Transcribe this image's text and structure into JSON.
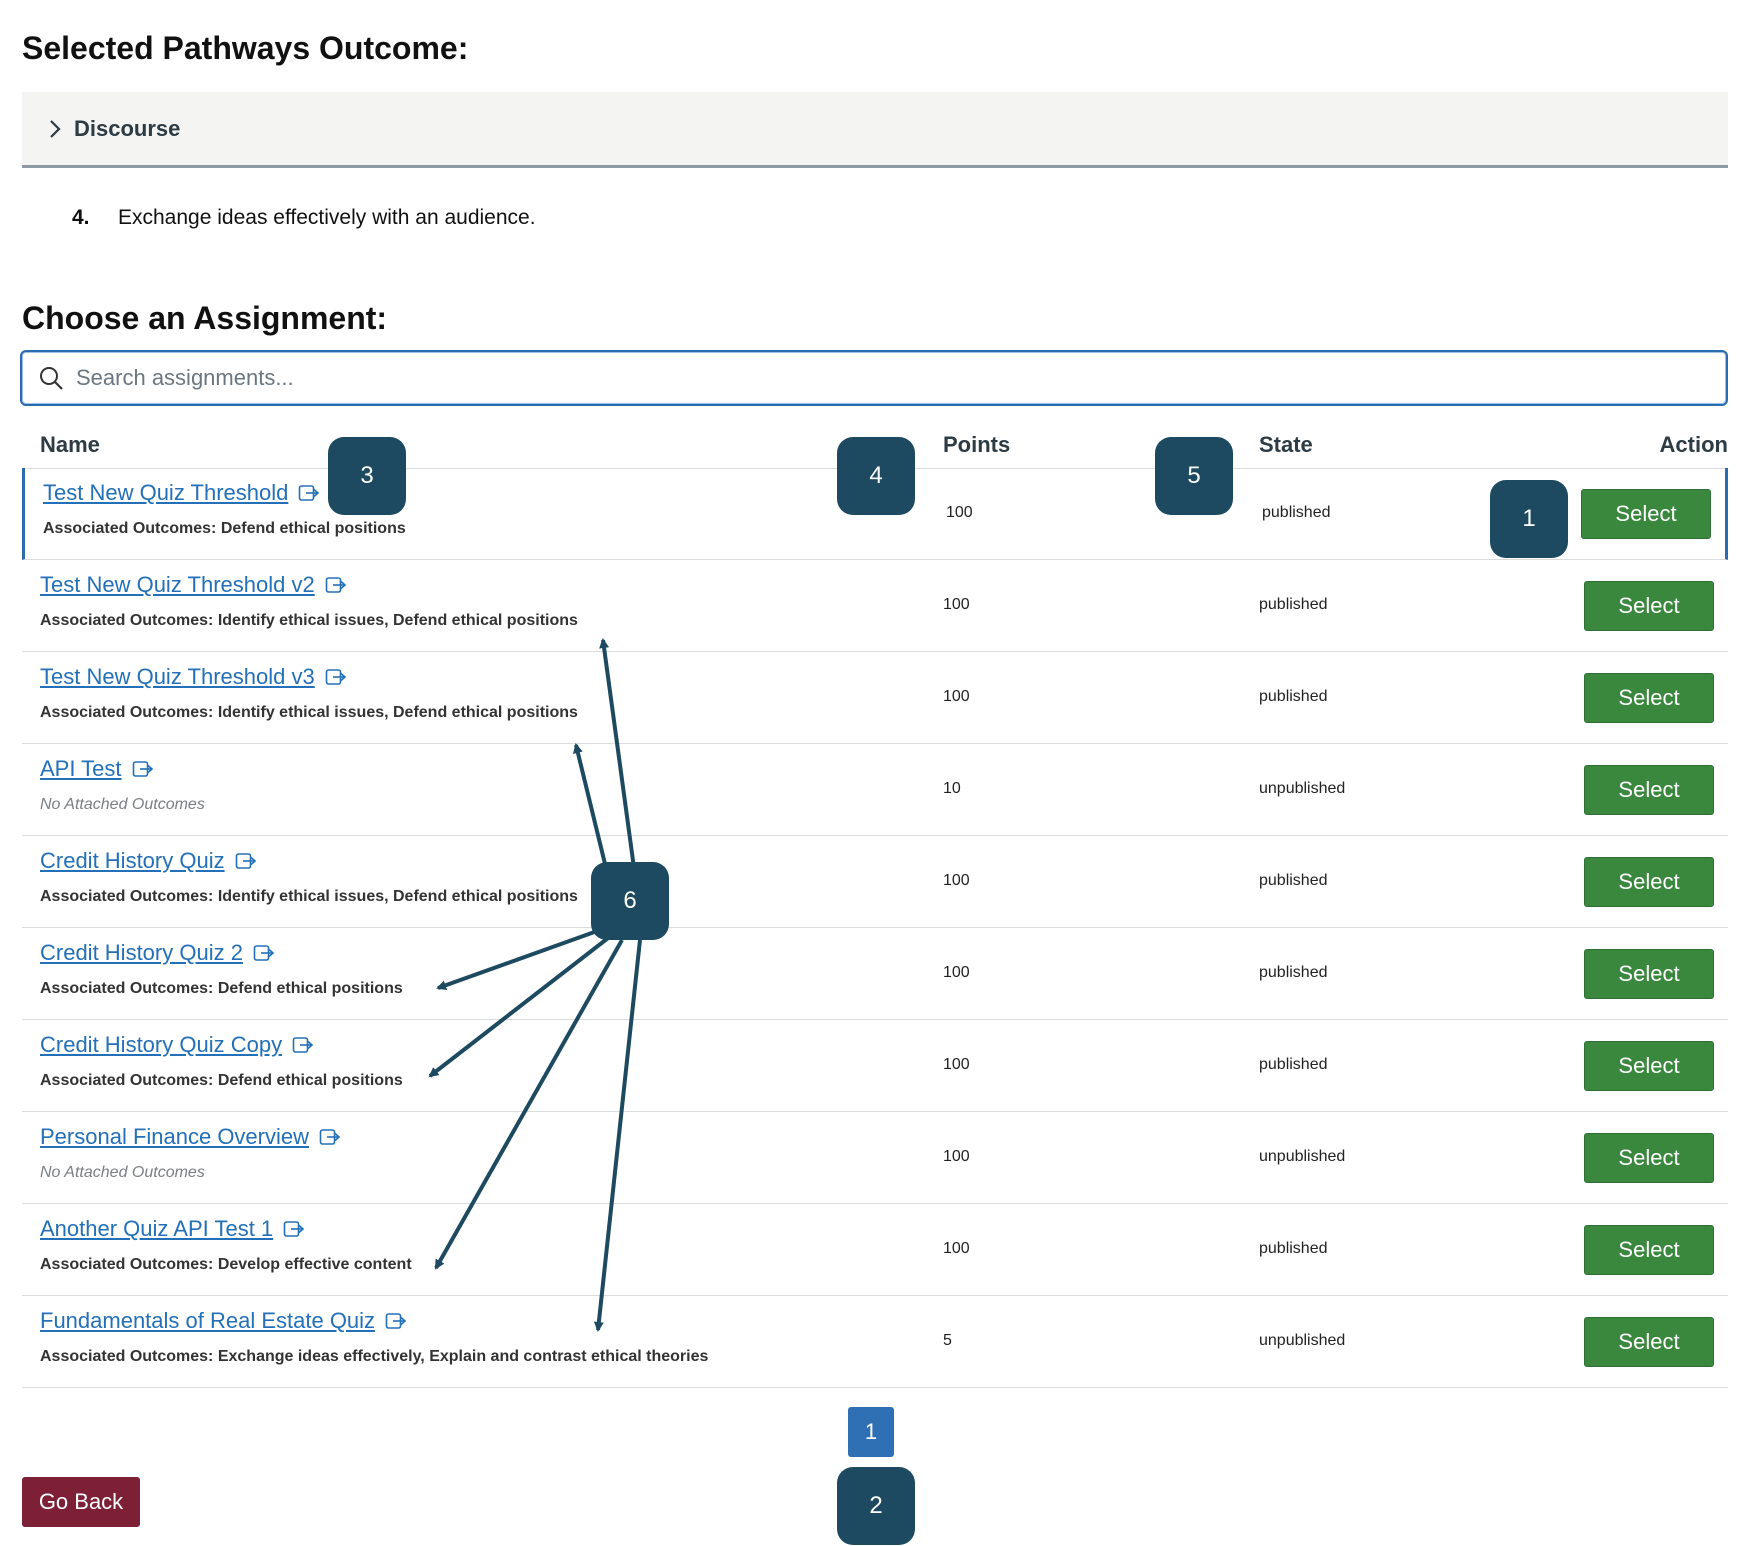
{
  "outcome_section": {
    "title": "Selected Pathways Outcome:",
    "accordion_label": "Discourse",
    "item_number": "4.",
    "item_text": "Exchange ideas effectively with an audience."
  },
  "assignment_section": {
    "title": "Choose an Assignment:",
    "search_placeholder": "Search assignments..."
  },
  "table": {
    "headers": {
      "name": "Name",
      "points": "Points",
      "state": "State",
      "action": "Action"
    },
    "rows": [
      {
        "title": "Test New Quiz Threshold",
        "outcomes": "Associated Outcomes: Defend ethical positions",
        "points": "100",
        "state": "published",
        "action": "Select"
      },
      {
        "title": "Test New Quiz Threshold v2",
        "outcomes": "Associated Outcomes: Identify ethical issues, Defend ethical positions",
        "points": "100",
        "state": "published",
        "action": "Select"
      },
      {
        "title": "Test New Quiz Threshold v3",
        "outcomes": "Associated Outcomes: Identify ethical issues, Defend ethical positions",
        "points": "100",
        "state": "published",
        "action": "Select"
      },
      {
        "title": "API Test",
        "outcomes": "No Attached Outcomes",
        "points": "10",
        "state": "unpublished",
        "action": "Select"
      },
      {
        "title": "Credit History Quiz",
        "outcomes": "Associated Outcomes: Identify ethical issues, Defend ethical positions",
        "points": "100",
        "state": "published",
        "action": "Select"
      },
      {
        "title": "Credit History Quiz 2",
        "outcomes": "Associated Outcomes: Defend ethical positions",
        "points": "100",
        "state": "published",
        "action": "Select"
      },
      {
        "title": "Credit History Quiz Copy",
        "outcomes": "Associated Outcomes: Defend ethical positions",
        "points": "100",
        "state": "published",
        "action": "Select"
      },
      {
        "title": "Personal Finance Overview",
        "outcomes": "No Attached Outcomes",
        "points": "100",
        "state": "unpublished",
        "action": "Select"
      },
      {
        "title": "Another Quiz API Test 1",
        "outcomes": "Associated Outcomes: Develop effective content",
        "points": "100",
        "state": "published",
        "action": "Select"
      },
      {
        "title": "Fundamentals of Real Estate Quiz",
        "outcomes": "Associated Outcomes: Exchange ideas effectively, Explain and contrast ethical theories",
        "points": "5",
        "state": "unpublished",
        "action": "Select"
      }
    ]
  },
  "pagination": {
    "current_page": "1"
  },
  "footer": {
    "go_back_label": "Go Back"
  },
  "annotations": {
    "badges": [
      "1",
      "2",
      "3",
      "4",
      "5",
      "6"
    ]
  },
  "colors": {
    "link": "#2370b8",
    "select_button": "#3a873e",
    "go_back_button": "#7d1f35",
    "page_button": "#2f6fb3",
    "badge": "#1d4a60",
    "focus_border": "#2b6cb0"
  },
  "icons": {
    "accordion": "chevron-right-icon",
    "search": "search-icon",
    "external": "external-link-icon"
  }
}
